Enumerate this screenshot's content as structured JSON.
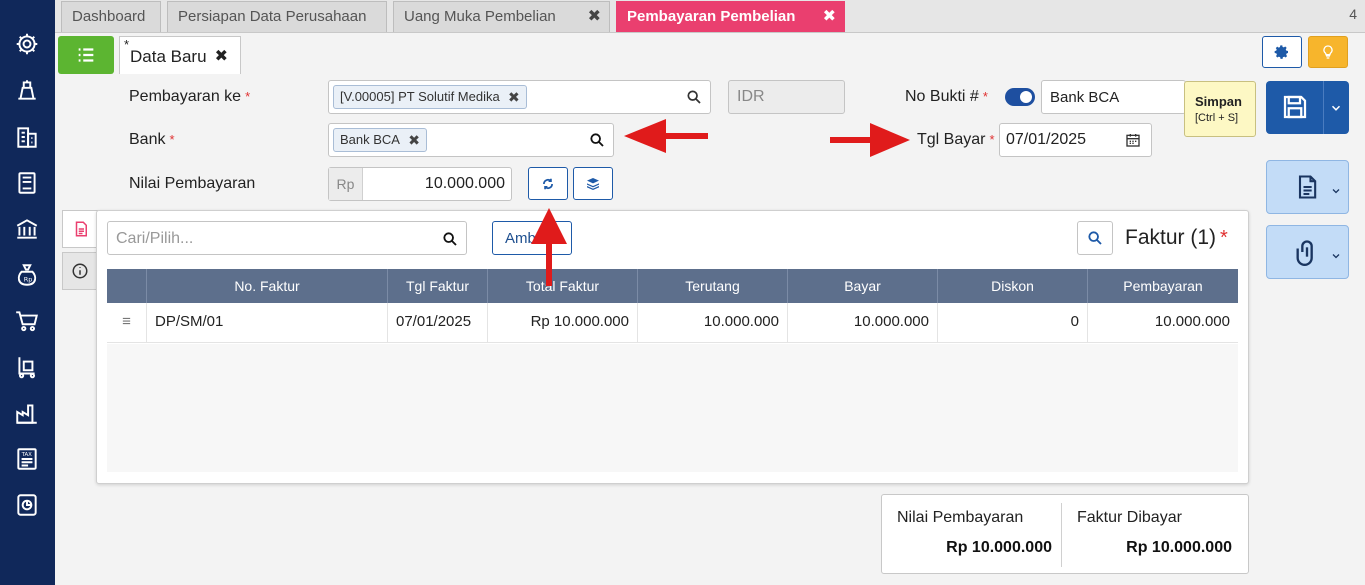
{
  "tabs": [
    {
      "label": "Dashboard",
      "closable": false
    },
    {
      "label": "Persiapan Data Perusahaan",
      "closable": false
    },
    {
      "label": "Uang Muka Pembelian",
      "closable": true
    },
    {
      "label": "Pembayaran Pembelian",
      "closable": true,
      "active": true
    }
  ],
  "tab_count": "4",
  "doc_tab": {
    "star": "*",
    "label": "Data Baru"
  },
  "form": {
    "pembayaran_ke": {
      "label": "Pembayaran ke",
      "value": "[V.00005] PT Solutif Medika"
    },
    "currency": "IDR",
    "bank": {
      "label": "Bank",
      "value": "Bank BCA"
    },
    "nilai_pembayaran": {
      "label": "Nilai Pembayaran",
      "prefix": "Rp",
      "value": "10.000.000"
    },
    "no_bukti": {
      "label": "No Bukti #",
      "value": "Bank BCA"
    },
    "tgl_bayar": {
      "label": "Tgl Bayar",
      "value": "07/01/2025"
    }
  },
  "required_mark": "*",
  "save_tooltip": {
    "title": "Simpan",
    "shortcut": "[Ctrl + S]"
  },
  "panel": {
    "search_placeholder": "Cari/Pilih...",
    "ambil_label": "Ambil",
    "title": "Faktur (1)",
    "columns": [
      "No. Faktur",
      "Tgl Faktur",
      "Total Faktur",
      "Terutang",
      "Bayar",
      "Diskon",
      "Pembayaran"
    ],
    "rows": [
      {
        "handle": "≡",
        "no_faktur": "DP/SM/01",
        "tgl_faktur": "07/01/2025",
        "total_faktur": "Rp 10.000.000",
        "terutang": "10.000.000",
        "bayar": "10.000.000",
        "diskon": "0",
        "pembayaran": "10.000.000"
      }
    ]
  },
  "summary": {
    "nilai_pembayaran": {
      "label": "Nilai Pembayaran",
      "value": "Rp 10.000.000"
    },
    "faktur_dibayar": {
      "label": "Faktur Dibayar",
      "value": "Rp 10.000.000"
    }
  },
  "colors": {
    "sidebar": "#10285a",
    "active_tab": "#ea3f6f",
    "primary": "#1e5aa8",
    "menu_green": "#5cb531",
    "annotation_red": "#e01b1b"
  },
  "icons": [
    "gear-icon",
    "scale-icon",
    "building-icon",
    "book-icon",
    "bank-icon",
    "money-bag-icon",
    "cart-icon",
    "trolley-icon",
    "factory-icon",
    "tax-icon",
    "chart-icon"
  ]
}
